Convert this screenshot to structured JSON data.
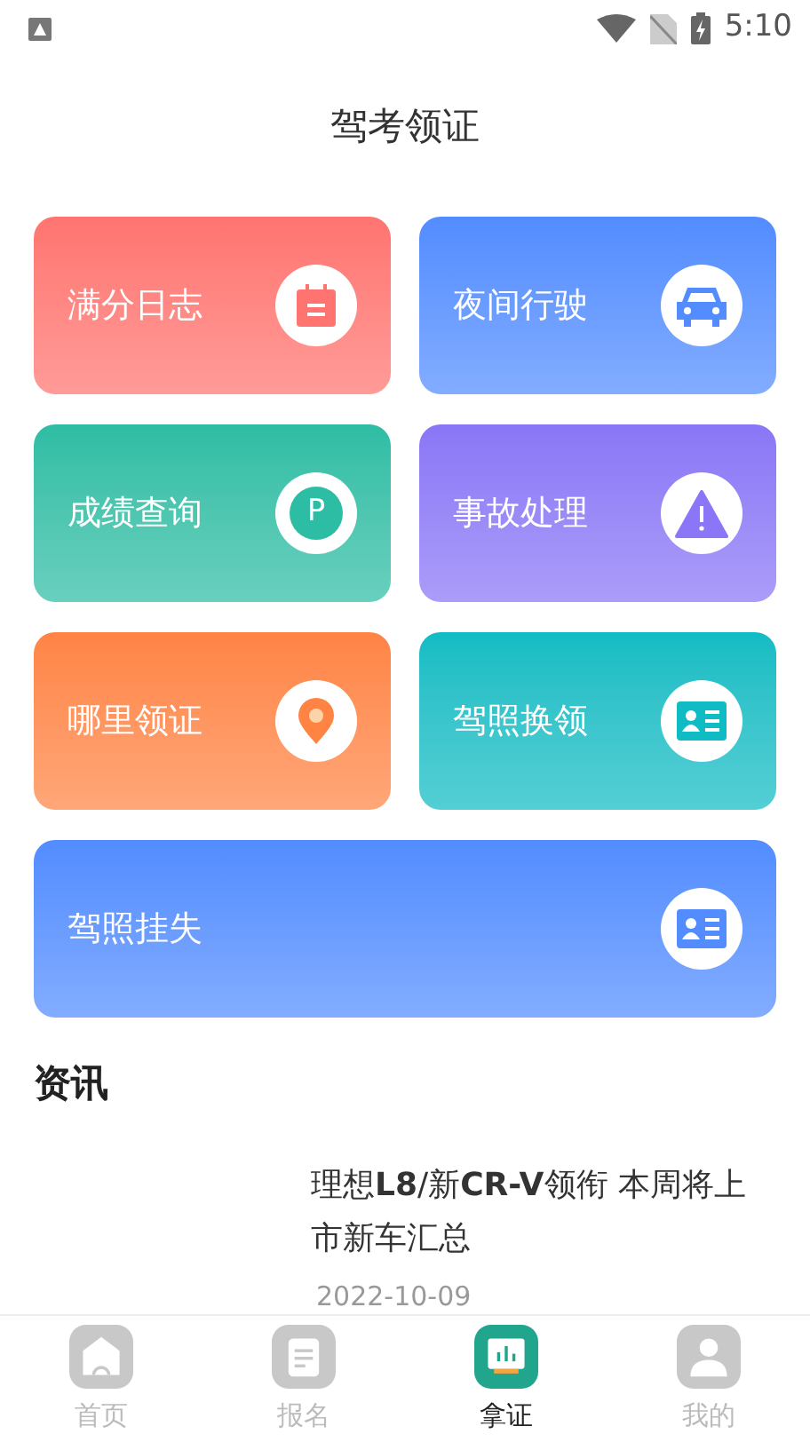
{
  "status_bar": {
    "time": "5:10"
  },
  "header": {
    "title": "驾考领证"
  },
  "cards": [
    {
      "label": "满分日志",
      "kind": "calendar",
      "color": "#ff7470"
    },
    {
      "label": "夜间行驶",
      "kind": "car",
      "color": "#528cff"
    },
    {
      "label": "成绩查询",
      "kind": "parking",
      "icon_text": "P",
      "color": "#2dbda4"
    },
    {
      "label": "事故处理",
      "kind": "warning",
      "color": "#8a76f6"
    },
    {
      "label": "哪里领证",
      "kind": "pin",
      "color": "#ff8444"
    },
    {
      "label": "驾照换领",
      "kind": "idcard",
      "color": "#10bcc4"
    },
    {
      "label": "驾照挂失",
      "kind": "idcard",
      "color": "#528cff",
      "wide": true
    }
  ],
  "news": {
    "heading": "资讯",
    "items": [
      {
        "title": "理想**L8**/新**CR-V**领衔 本周将上市新车汇总",
        "date": "2022-10-09"
      }
    ]
  },
  "tabs": [
    {
      "label": "首页",
      "kind": "home",
      "selected": false
    },
    {
      "label": "报名",
      "kind": "clipboard",
      "selected": false
    },
    {
      "label": "拿证",
      "kind": "board",
      "selected": true
    },
    {
      "label": "我的",
      "kind": "user",
      "selected": false
    }
  ]
}
